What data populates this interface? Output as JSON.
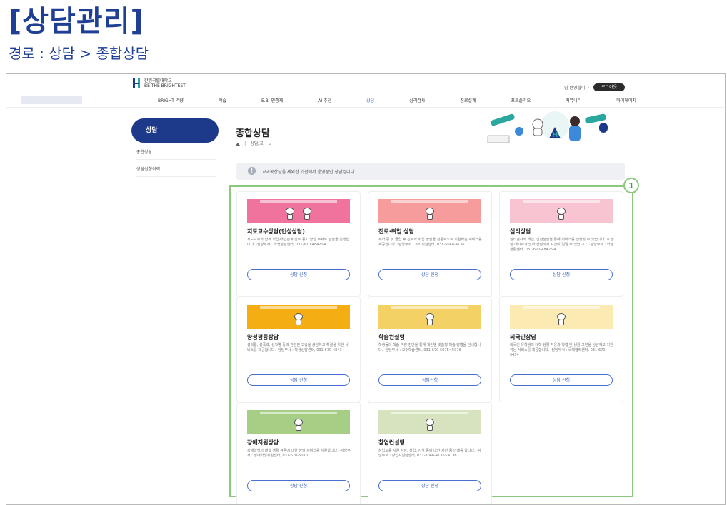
{
  "heading": "[상담관리]",
  "route": "경로 : 상담 > 종합상담",
  "site": {
    "logo_line1": "한경국립대학교",
    "logo_line2": "BE THE BRIGHTEST",
    "login_link": "님 환영합니다",
    "logout_button": "로그아웃"
  },
  "gnb": [
    "BRIGHT 역량",
    "학습",
    "E.B. 인증제",
    "AI 추천",
    "상담",
    "심리검사",
    "진로설계",
    "포트폴리오",
    "커뮤니티",
    "마이페이지"
  ],
  "sidebar": {
    "active": "상담",
    "items": [
      "종합상담",
      "상담신청이력"
    ]
  },
  "page": {
    "title": "종합상담",
    "crumb": "상담/교"
  },
  "notice": "교과목상담을 제외한 기관에서 운영중인 상담입니다.",
  "callout_number": "1",
  "cards": [
    {
      "title": "지도교수상담(인성상담)",
      "desc": "지도교수와 함께 학업·대인관계·진로 등 다양한 주제로 상담을 진행합니다. ·담당부서 : 학생상담센터, 031-670-4842~4",
      "button": "상담 신청",
      "color": "#f0739d"
    },
    {
      "title": "진로·취업 상담",
      "desc": "재학 중 및 졸업 후 진로와 취업 상담을 전문적으로 지원하는 서비스를 제공합니다. ·담당부서 : 조직지원센터, 031-5048-4136",
      "button": "상담 신청",
      "color": "#f69c9c"
    },
    {
      "title": "심리상담",
      "desc": "심리검사와 개인, 집단상담을 통해 서비스를 진행할 수 있습니다. ※ 상담 대기자가 많아 상담까지 시간이 걸릴 수 있습니다. ·담당부서 : 학생생활센터, 031-670-4842~4",
      "button": "상담 신청",
      "color": "#f8c4d2"
    },
    {
      "title": "양성평등상담",
      "desc": "성희롱, 성폭력, 성차별 등과 관련된 고충을 상담하고 해결을 위한 서비스를 제공합니다. ·담당부서 : 학생상담센터, 031-670-4843",
      "button": "상담 신청",
      "color": "#f5ad14"
    },
    {
      "title": "학습컨설팅",
      "desc": "학생들의 학습 역량 진단을 통해 개인별 맞춤형 학습 방법을 안내합니다. ·담당부서 : 교수학습센터, 031-670-5075~5076",
      "button": "상담신청",
      "color": "#f3d165"
    },
    {
      "title": "외국인상담",
      "desc": "외국인 유학생의 대학 생활 적응과 학업 및 생활 고민을 상담하고 지원하는 서비스를 제공합니다. ·담당부서 : 국제협력센터, 031-670-5454",
      "button": "상담 신청",
      "color": "#fbeab2"
    },
    {
      "title": "장애지원상담",
      "desc": "장애학생의 대학 생활 적응에 대한 상담 서비스를 지원합니다. ·담당부서 : 장애학생지원센터, 031-670-5070",
      "button": "상담 신청",
      "color": "#a6cf85"
    },
    {
      "title": "창업컨설팅",
      "desc": "창업교육 지원 상담, 창업, 지식 등에 대한 지원 등 안내를 합니다. ·담당부서 : 창업지원단센터, 031-8046-4136~4136",
      "button": "상담 신청",
      "color": "#d7e3bf"
    }
  ]
}
